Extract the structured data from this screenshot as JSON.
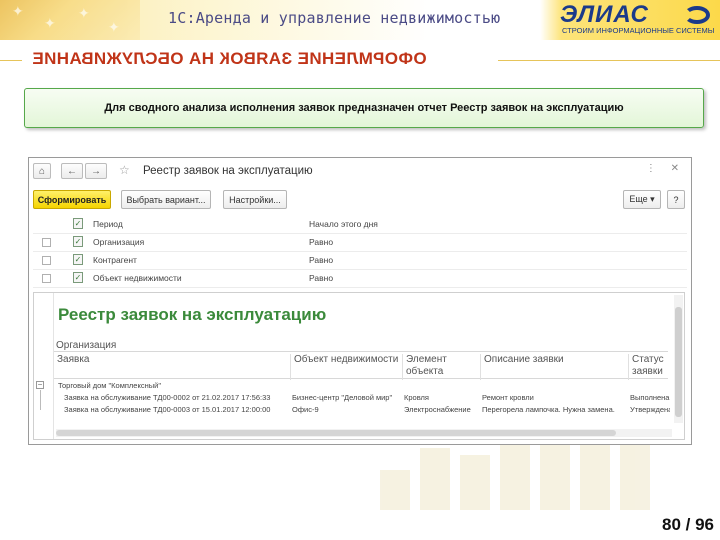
{
  "slide": {
    "app_title": "1С:Аренда и управление недвижимостью",
    "logo_text": "ЭЛИАС",
    "logo_subtitle": "СТРОИМ ИНФОРМАЦИОННЫЕ СИСТЕМЫ",
    "section_title": "ОФОРМЛЕНИЕ ЗАЯВОК НА ОБСЛУЖИВАНИЕ",
    "info_text": "Для сводного анализа исполнения заявок предназначен отчет Реестр заявок на эксплуатацию",
    "page_number": "80 / 96"
  },
  "window": {
    "title": "Реестр заявок на эксплуатацию",
    "nav": {
      "home": "⌂",
      "back": "←",
      "forward": "→",
      "favorite": "☆"
    },
    "toolbar": {
      "generate": "Сформировать",
      "choose_variant": "Выбрать вариант...",
      "settings": "Настройки...",
      "more": "Еще ▾",
      "help": "?"
    },
    "settings_rows": [
      {
        "name": "Период",
        "value": "Начало этого дня",
        "has_checkbox": false
      },
      {
        "name": "Организация",
        "value": "Равно",
        "has_checkbox": true
      },
      {
        "name": "Контрагент",
        "value": "Равно",
        "has_checkbox": true
      },
      {
        "name": "Объект недвижимости",
        "value": "Равно",
        "has_checkbox": true
      }
    ],
    "report": {
      "title": "Реестр заявок на эксплуатацию",
      "group_label": "Организация",
      "columns": [
        "Заявка",
        "Объект недвижимости",
        "Элемент объекта",
        "Описание заявки",
        "Статус заявки"
      ],
      "group_row": "Торговый дом \"Комплексный\"",
      "rows": [
        [
          "Заявка на обслуживание ТД00-0002 от 21.02.2017 17:56:33",
          "Бизнес-центр \"Деловой мир\"",
          "Кровля",
          "Ремонт кровли",
          "Выполнена"
        ],
        [
          "Заявка на обслуживание ТД00-0003 от 15.01.2017 12:00:00",
          "Офис-9",
          "Электроснабжение",
          "Перегорела лампочка. Нужна замена.",
          "Утверждена"
        ]
      ]
    }
  }
}
